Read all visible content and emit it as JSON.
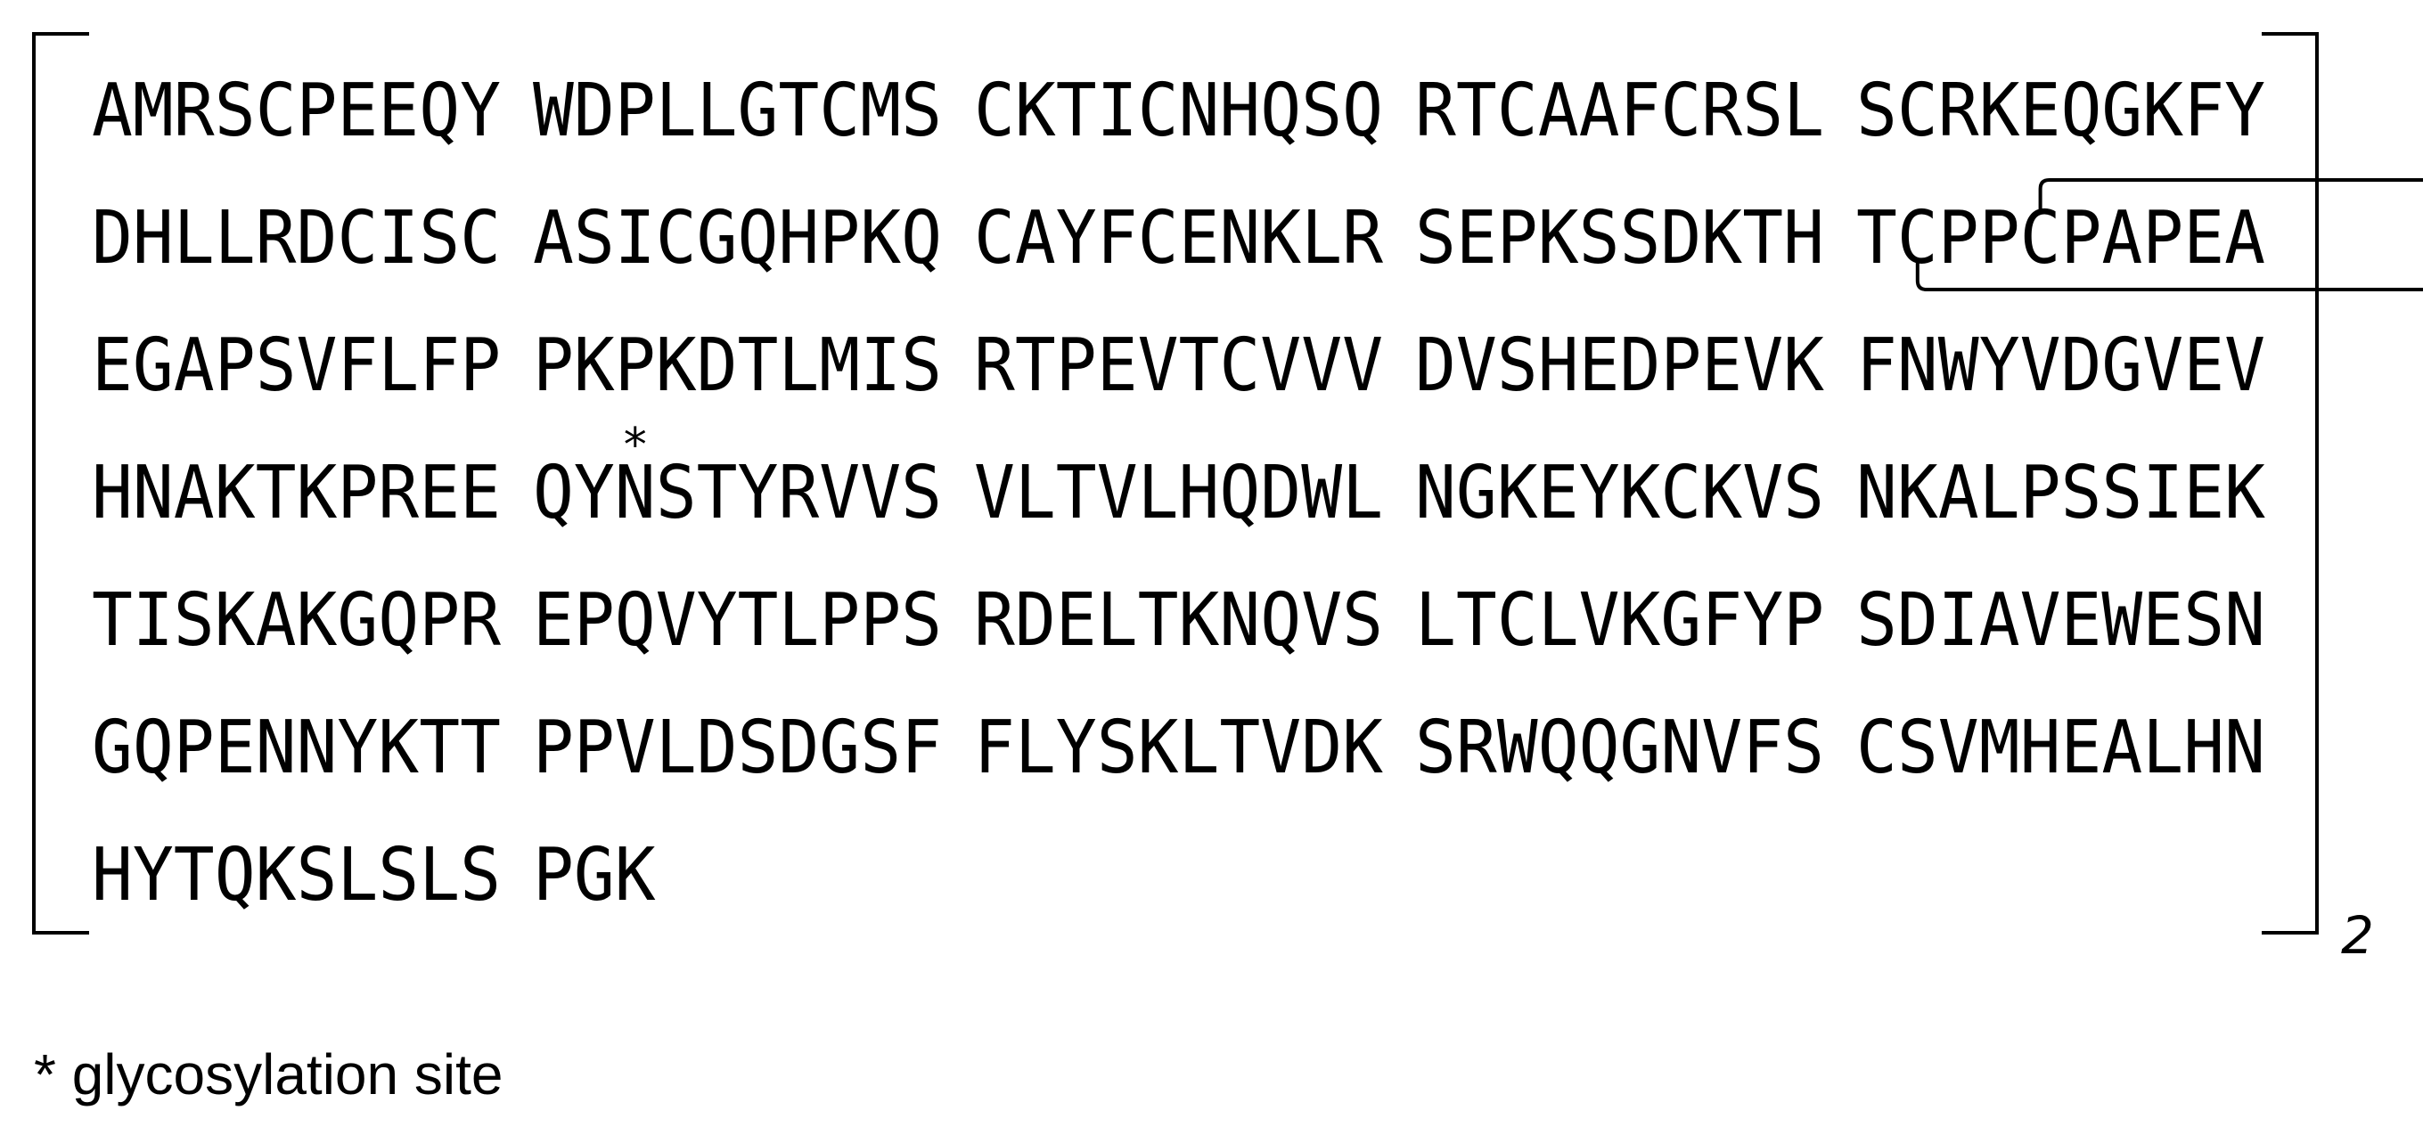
{
  "sequence_rows": [
    [
      "AMRSCPEEQY",
      "WDPLLGTCMS",
      "CKTICNHQSQ",
      "RTCAAFCRSL",
      "SCRKEQGKFY"
    ],
    [
      "DHLLRDCISC",
      "ASICGQHPKQ",
      "CAYFCENKLR",
      "SEPKSSDKTH",
      "TCPPCPAPEA"
    ],
    [
      "EGAPSVFLFP",
      "PKPKDTLMIS",
      "RTPEVTCVVV",
      "DVSHEDPEVK",
      "FNWYVDGVEV"
    ],
    [
      "HNAKTKPREE",
      "QYNSTYRVVS",
      "VLTVLHQDWL",
      "NGKEYKCKVS",
      "NKALPSSIEK"
    ],
    [
      "TISKAKGQPR",
      "EPQVYTLPPS",
      "RDELTKNQVS",
      "LTCLVKGFYP",
      "SDIAVEWESN"
    ],
    [
      "GQPENNYKTT",
      "PPVLDSDGSF",
      "FLYSKLTVDK",
      "SRWQQGNVFS",
      "CSVMHEALHN"
    ],
    [
      "HYTQKSLSLS",
      "PGK"
    ]
  ],
  "glycosylation_marker": "*",
  "bracket_subscript": "2",
  "legend": "* glycosylation site",
  "annotations": {
    "glycosylation_site": {
      "row": 3,
      "block": 1,
      "char": 2
    },
    "interchain_disulfides": [
      {
        "row": 1,
        "block": 4,
        "char": 4
      },
      {
        "row": 1,
        "block": 4,
        "char": 1
      }
    ]
  }
}
